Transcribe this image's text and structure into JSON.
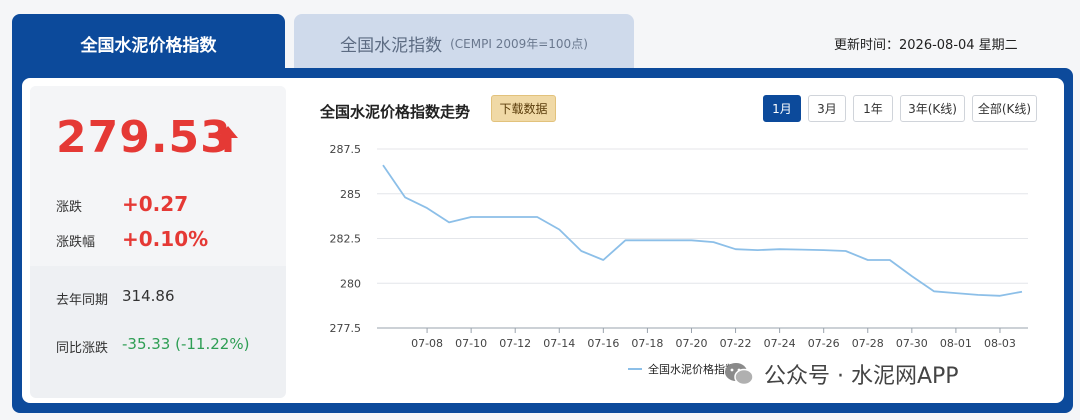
{
  "tabs": {
    "active_label": "全国水泥价格指数",
    "inactive_label": "全国水泥指数",
    "inactive_sub": "(CEMPI 2009年=100点)"
  },
  "update_time": "更新时间：2026-08-04 星期二",
  "summary": {
    "value": "279.53",
    "change_label": "涨跌",
    "change_value": "+0.27",
    "pct_label": "涨跌幅",
    "pct_value": "+0.10%",
    "last_year_label": "去年同期",
    "last_year_value": "314.86",
    "yoy_label": "同比涨跌",
    "yoy_value": "-35.33 (-11.22%)",
    "colors": {
      "up": "#e53935",
      "down": "#2e9e54"
    }
  },
  "chart_header": {
    "title": "全国水泥价格指数走势",
    "download_label": "下载数据",
    "ranges": [
      "1月",
      "3月",
      "1年",
      "3年(K线)",
      "全部(K线)"
    ],
    "active_range": "1月"
  },
  "watermark": "公众号 · 水泥网APP",
  "chart_data": {
    "type": "line",
    "x": [
      "07-06",
      "07-07",
      "07-08",
      "07-09",
      "07-10",
      "07-11",
      "07-12",
      "07-13",
      "07-14",
      "07-15",
      "07-16",
      "07-17",
      "07-18",
      "07-19",
      "07-20",
      "07-21",
      "07-22",
      "07-23",
      "07-24",
      "07-25",
      "07-26",
      "07-27",
      "07-28",
      "07-29",
      "07-30",
      "07-31",
      "08-01",
      "08-02",
      "08-03",
      "08-04"
    ],
    "series": [
      {
        "name": "全国水泥价格指数",
        "color": "#8cbfe8",
        "values": [
          286.6,
          284.8,
          284.2,
          283.4,
          283.7,
          283.7,
          283.7,
          283.7,
          283.0,
          281.8,
          281.3,
          282.4,
          282.4,
          282.4,
          282.4,
          282.3,
          281.9,
          281.85,
          281.9,
          281.88,
          281.85,
          281.8,
          281.3,
          281.3,
          280.4,
          279.55,
          279.45,
          279.35,
          279.3,
          279.53
        ]
      }
    ],
    "x_tick_labels": [
      "07-08",
      "07-10",
      "07-12",
      "07-14",
      "07-16",
      "07-18",
      "07-20",
      "07-22",
      "07-24",
      "07-26",
      "07-28",
      "07-30",
      "08-01",
      "08-03"
    ],
    "y_ticks": [
      277.5,
      280,
      282.5,
      285,
      287.5
    ],
    "y_tick_labels": [
      "277.5",
      "280",
      "282.5",
      "285",
      "287.5"
    ],
    "ylim": [
      277.5,
      287.5
    ],
    "grid": true,
    "legend": "bottom-center"
  }
}
